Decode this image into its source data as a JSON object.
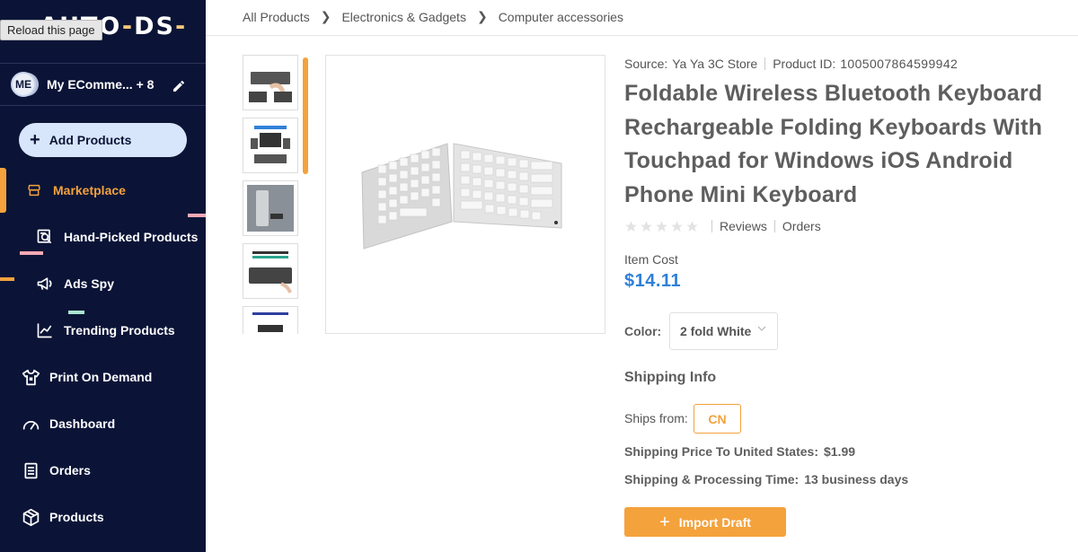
{
  "app": {
    "logo": "AUTO-DS-",
    "tooltip": "Reload this page"
  },
  "colors": {
    "sidebar_bg": "#0b1437",
    "accent_orange": "#f4a23c",
    "price_blue": "#2f80d9"
  },
  "sidebar": {
    "store": {
      "avatar": "ME",
      "name": "My ECommerce Store",
      "extra": "+ 8"
    },
    "add_products": "Add Products",
    "items": [
      {
        "label": "Marketplace",
        "icon": "store-icon",
        "active": true
      },
      {
        "label": "Hand-Picked Products",
        "icon": "search-list-icon"
      },
      {
        "label": "Ads Spy",
        "icon": "megaphone-icon"
      },
      {
        "label": "Trending Products",
        "icon": "trending-icon"
      },
      {
        "label": "Print On Demand",
        "icon": "tshirt-icon"
      },
      {
        "label": "Dashboard",
        "icon": "gauge-icon"
      },
      {
        "label": "Orders",
        "icon": "clipboard-icon"
      },
      {
        "label": "Products",
        "icon": "box-icon"
      }
    ]
  },
  "breadcrumb": [
    "All Products",
    "Electronics & Gadgets",
    "Computer accessories"
  ],
  "product": {
    "source_label": "Source:",
    "source": "Ya Ya 3C Store",
    "product_id_label": "Product ID:",
    "product_id": "1005007864599942",
    "title": "Foldable Wireless Bluetooth Keyboard Rechargeable Folding Keyboards With Touchpad for Windows iOS Android Phone Mini Keyboard",
    "rating_stars": 0,
    "reviews_label": "Reviews",
    "orders_label": "Orders",
    "item_cost_label": "Item Cost",
    "price": "$14.11",
    "color_label": "Color:",
    "color_value": "2 fold White"
  },
  "shipping": {
    "title": "Shipping Info",
    "ships_from_label": "Ships from:",
    "ships_from": "CN",
    "price_label": "Shipping Price To United States:",
    "price": "$1.99",
    "time_label": "Shipping & Processing Time:",
    "time": "13 business days"
  },
  "actions": {
    "import_draft": "Import Draft"
  }
}
